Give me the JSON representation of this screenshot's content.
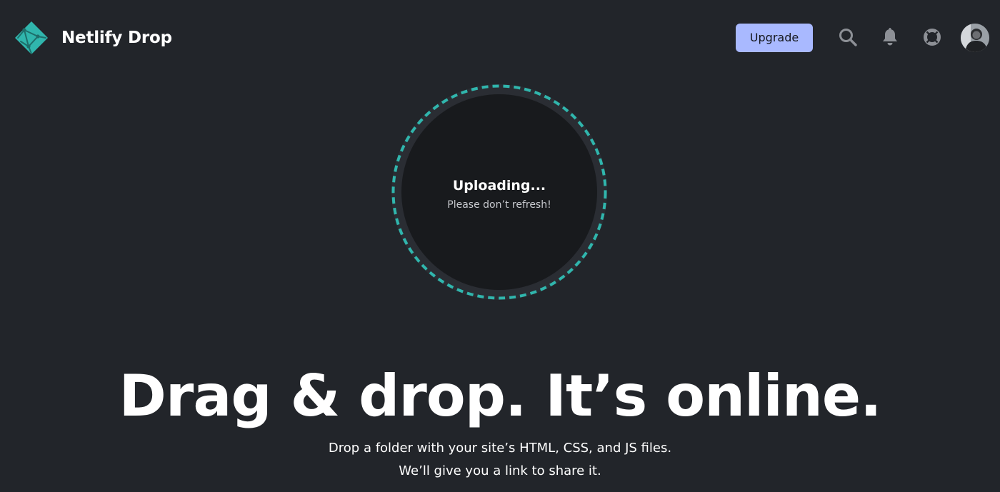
{
  "header": {
    "brand_name": "Netlify Drop",
    "upgrade_label": "Upgrade",
    "icons": {
      "logo": "netlify-logo-icon",
      "search": "search-icon",
      "notifications": "bell-icon",
      "help": "lifebuoy-icon",
      "avatar": "user-avatar"
    }
  },
  "dropzone": {
    "status": "Uploading...",
    "hint": "Please don’t refresh!"
  },
  "hero": {
    "title": "Drag & drop. It’s online.",
    "line1": "Drop a folder with your site’s HTML, CSS, and JS files.",
    "line2": "We’ll give you a link to share it."
  },
  "colors": {
    "background": "#22252a",
    "accent_teal": "#30b6ad",
    "upgrade_button": "#a9b9ff",
    "dropzone_inner": "#181a1d",
    "icon_gray": "#8d9096"
  }
}
